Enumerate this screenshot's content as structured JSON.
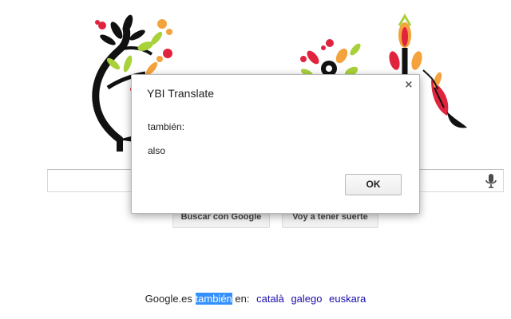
{
  "doodle": {
    "icon": "floral-doodle-logo"
  },
  "search": {
    "value": "",
    "placeholder": ""
  },
  "buttons": {
    "search_label": "Buscar con Google",
    "lucky_label": "Voy a tener suerte"
  },
  "language_line": {
    "prefix": "Google.es",
    "highlighted": "también",
    "suffix": "en:",
    "languages": [
      "català",
      "galego",
      "euskara"
    ]
  },
  "dialog": {
    "title": "YBI Translate",
    "close_glyph": "×",
    "source_text": "también:",
    "translation": "also",
    "ok_label": "OK"
  },
  "colors": {
    "link": "#1a0dab",
    "selection": "#3390ff",
    "doodle_red": "#e0243e",
    "doodle_orange": "#f4a23c",
    "doodle_green": "#a8d13a"
  }
}
